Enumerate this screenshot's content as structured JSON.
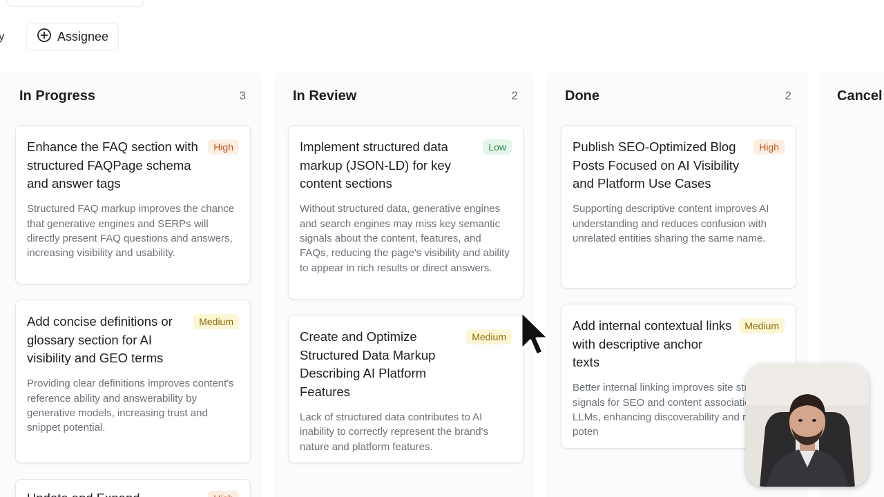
{
  "filters": {
    "partial_label": "y",
    "assignee_label": "Assignee"
  },
  "columns": [
    {
      "title": "In Progress",
      "count": "3",
      "cards": [
        {
          "title": "Enhance the FAQ section with structured FAQPage schema and answer tags",
          "priority": "High",
          "description": "Structured FAQ markup improves the chance that generative engines and SERPs will directly present FAQ questions and answers, increasing visibility and usability."
        },
        {
          "title": "Add concise definitions or glossary section for AI visibility and GEO terms",
          "priority": "Medium",
          "description": "Providing clear definitions improves content's reference ability and answerability by generative models, increasing trust and snippet potential."
        },
        {
          "title": "Update and Expand",
          "priority": "High",
          "description": ""
        }
      ]
    },
    {
      "title": "In Review",
      "count": "2",
      "cards": [
        {
          "title": "Implement structured data markup (JSON-LD) for key content sections",
          "priority": "Low",
          "description": "Without structured data, generative engines and search engines may miss key semantic signals about the content, features, and FAQs, reducing the page's visibility and ability to appear in rich results or direct answers."
        },
        {
          "title": "Create and Optimize Structured Data Markup Describing AI Platform Features",
          "priority": "Medium",
          "description": "Lack of structured data contributes to AI inability to correctly represent the brand's nature and platform features."
        }
      ]
    },
    {
      "title": "Done",
      "count": "2",
      "cards": [
        {
          "title": "Publish SEO-Optimized Blog Posts Focused on AI Visibility and Platform Use Cases",
          "priority": "High",
          "description": "Supporting descriptive content improves AI understanding and reduces confusion with unrelated entities sharing the same name."
        },
        {
          "title": "Add internal contextual links with descriptive anchor texts",
          "priority": "Medium",
          "description": "Better internal linking improves site structure signals for SEO and content association for LLMs, enhancing discoverability and ranking poten"
        }
      ]
    },
    {
      "title": "Cancel",
      "count": "",
      "cards": []
    }
  ]
}
